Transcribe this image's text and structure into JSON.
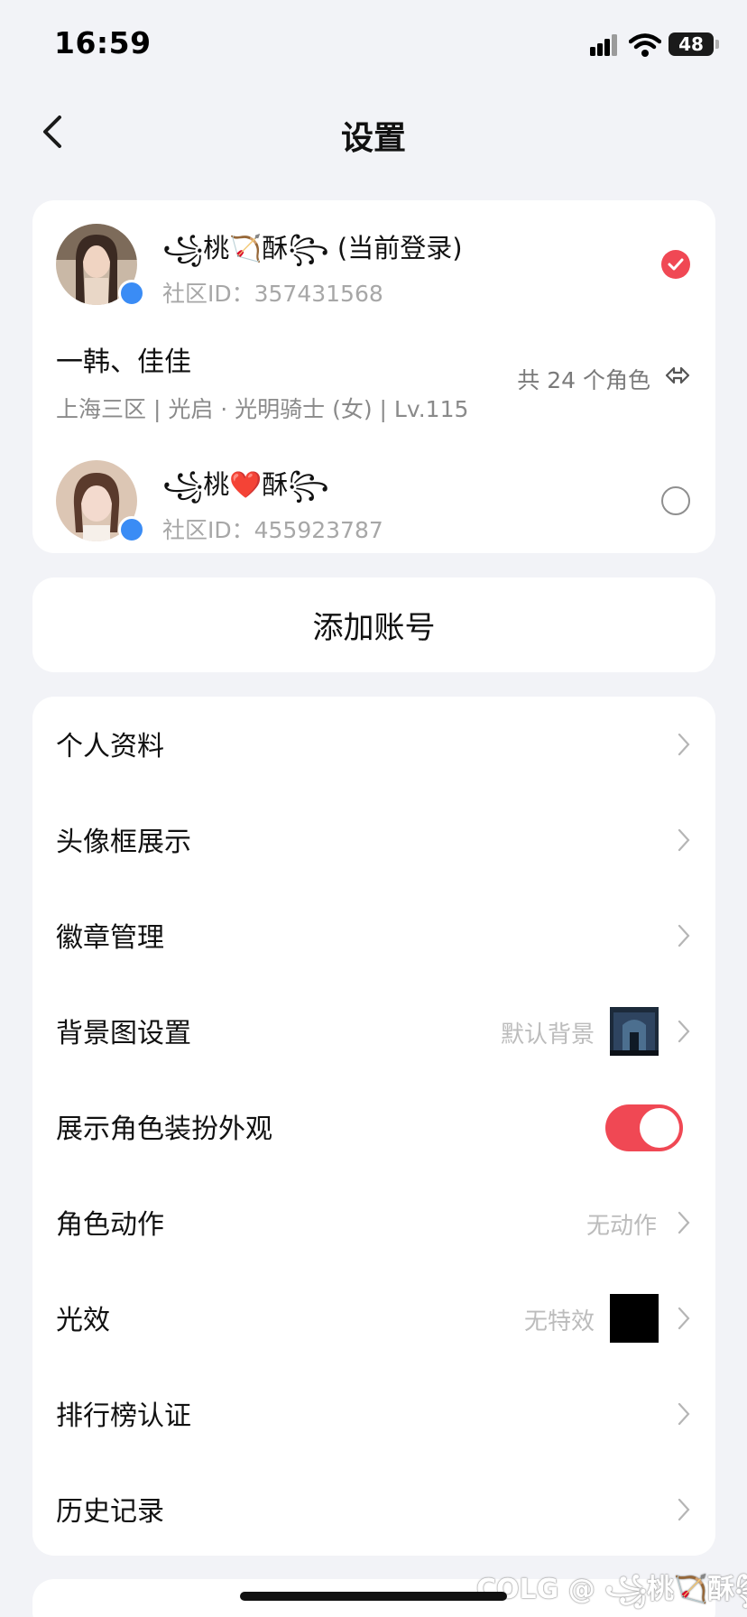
{
  "status_bar": {
    "time": "16:59",
    "battery": "48"
  },
  "header": {
    "title": "设置"
  },
  "accounts": [
    {
      "name": "꧁桃🏹酥꧂ (当前登录)",
      "id_label": "社区ID：",
      "id": "357431568",
      "selected": true
    },
    {
      "name": "꧁桃❤️酥꧂",
      "id_label": "社区ID：",
      "id": "455923787",
      "selected": false
    }
  ],
  "role": {
    "name": "一韩、佳佳",
    "info": "上海三区 | 光启 · 光明骑士 (女) | Lv.115",
    "count": "共 24 个角色"
  },
  "add_account": {
    "label": "添加账号"
  },
  "menu": {
    "profile": "个人资料",
    "avatar_frame": "头像框展示",
    "badges": "徽章管理",
    "background": "背景图设置",
    "background_value": "默认背景",
    "show_outfit": "展示角色装扮外观",
    "show_outfit_on": true,
    "actions": "角色动作",
    "actions_value": "无动作",
    "effects": "光效",
    "effects_value": "无特效",
    "leaderboard": "排行榜认证",
    "history": "历史记录"
  },
  "watermark": "COLG @ ꧁桃🏹酥꧂",
  "colors": {
    "accent": "#f04854",
    "background": "#f2f3f7",
    "card": "#ffffff",
    "qq_blue": "#3a8cf5"
  }
}
